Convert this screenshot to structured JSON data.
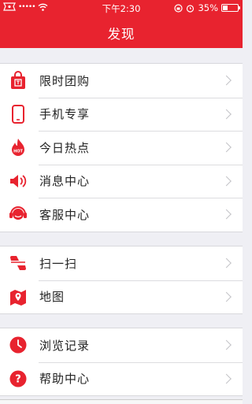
{
  "status_bar": {
    "time": "下午2:30",
    "battery": "35%",
    "battery_level": 0.35
  },
  "header": {
    "title": "发现"
  },
  "groups": [
    {
      "items": [
        {
          "label": "限时团购",
          "icon": "shopping-bag-icon"
        },
        {
          "label": "手机专享",
          "icon": "phone-icon"
        },
        {
          "label": "今日热点",
          "icon": "hot-flame-icon"
        },
        {
          "label": "消息中心",
          "icon": "speaker-icon"
        },
        {
          "label": "客服中心",
          "icon": "headset-icon"
        }
      ]
    },
    {
      "items": [
        {
          "label": "扫一扫",
          "icon": "scan-icon"
        },
        {
          "label": "地图",
          "icon": "map-icon"
        }
      ]
    },
    {
      "items": [
        {
          "label": "浏览记录",
          "icon": "clock-icon"
        },
        {
          "label": "帮助中心",
          "icon": "help-icon"
        }
      ]
    }
  ],
  "colors": {
    "accent": "#e8232f",
    "background": "#efeff4"
  }
}
